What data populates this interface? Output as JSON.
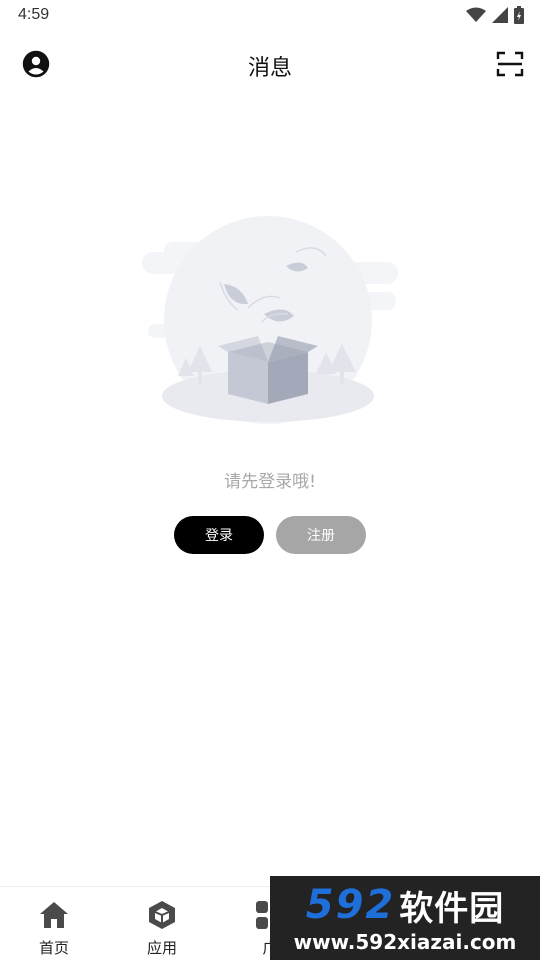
{
  "status_bar": {
    "time": "4:59",
    "icons": [
      "wifi-icon",
      "signal-icon",
      "battery-icon"
    ]
  },
  "header": {
    "title": "消息",
    "left_icon": "profile-icon",
    "right_icon": "scan-icon"
  },
  "empty_state": {
    "illustration": "empty-box-illustration",
    "message": "请先登录哦!"
  },
  "buttons": {
    "login": "登录",
    "register": "注册"
  },
  "tab_bar": {
    "tabs": [
      {
        "label": "首页",
        "icon": "home-icon"
      },
      {
        "label": "应用",
        "icon": "cube-icon"
      },
      {
        "label": "广",
        "icon": "grid-icon"
      }
    ]
  },
  "watermark": {
    "brand_number": "592",
    "brand_text": "软件园",
    "url": "www.592xiazai.com"
  },
  "colors": {
    "primary_button": "#000000",
    "secondary_button": "#a6a6a6",
    "placeholder_text": "#a8a8a8",
    "watermark_blue": "#1e6fd9"
  }
}
